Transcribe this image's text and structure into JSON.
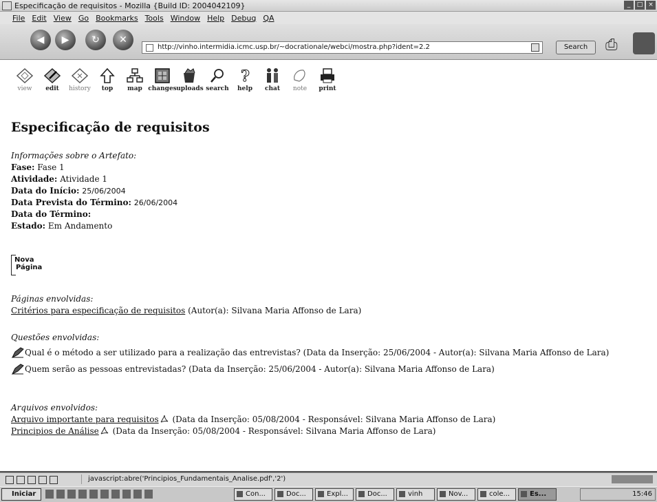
{
  "window": {
    "title": "Especificação de requisitos - Mozilla {Build ID: 2004042109}"
  },
  "menu": [
    "File",
    "Edit",
    "View",
    "Go",
    "Bookmarks",
    "Tools",
    "Window",
    "Help",
    "Debug",
    "QA"
  ],
  "nav": {
    "url": "http://vinho.intermidia.icmc.usp.br/~docrationale/webci/mostra.php?ident=2.2",
    "search_label": "Search"
  },
  "toolbar": [
    {
      "label": "view",
      "icon": "view-icon"
    },
    {
      "label": "edit",
      "icon": "edit-icon"
    },
    {
      "label": "history",
      "icon": "history-icon"
    },
    {
      "label": "top",
      "icon": "arrow-up-icon"
    },
    {
      "label": "map",
      "icon": "sitemap-icon"
    },
    {
      "label": "changes",
      "icon": "changes-icon"
    },
    {
      "label": "uploads",
      "icon": "uploads-icon"
    },
    {
      "label": "search",
      "icon": "magnifier-icon"
    },
    {
      "label": "help",
      "icon": "question-icon"
    },
    {
      "label": "chat",
      "icon": "people-icon"
    },
    {
      "label": "note",
      "icon": "note-icon"
    },
    {
      "label": "print",
      "icon": "printer-icon"
    }
  ],
  "page": {
    "title": "Especificação de requisitos",
    "info_heading": "Informações sobre o Artefato:",
    "fields": [
      {
        "label": "Fase:",
        "value": "Fase 1"
      },
      {
        "label": "Atividade:",
        "value": "Atividade 1"
      },
      {
        "label": "Data do Início:",
        "value": "25/06/2004"
      },
      {
        "label": "Data Prevista do Término:",
        "value": "26/06/2004"
      },
      {
        "label": "Data do Término:",
        "value": ""
      },
      {
        "label": "Estado:",
        "value": "Em Andamento"
      }
    ],
    "nova_pagina": {
      "line1": "Nova",
      "line2": "Página"
    },
    "paginas_heading": "Páginas envolvidas:",
    "paginas": [
      {
        "link": "Critérios para especificação de requisitos",
        "info": "(Autor(a): Silvana Maria Affonso de Lara)"
      }
    ],
    "questoes_heading": "Questões envolvidas:",
    "questoes": [
      {
        "text": "Qual é o método a ser utilizado para a realização das entrevistas? (Data da Inserção: 25/06/2004 - Autor(a): Silvana Maria Affonso de Lara)"
      },
      {
        "text": "Quem serão as pessoas entrevistadas? (Data da Inserção: 25/06/2004 - Autor(a): Silvana Maria Affonso de Lara)"
      }
    ],
    "arquivos_heading": "Arquivos envolvidos:",
    "arquivos": [
      {
        "link": "Arquivo importante para requisitos",
        "info": "(Data da Inserção: 05/08/2004 - Responsável: Silvana Maria Affonso de Lara)"
      },
      {
        "link": "Principios de Análise",
        "info": "(Data da Inserção: 05/08/2004 - Responsável: Silvana Maria Affonso de Lara)"
      }
    ]
  },
  "status": {
    "text": "javascript:abre('Principios_Fundamentais_Analise.pdf','2')"
  },
  "taskbar": {
    "start": "Iniciar",
    "tasks": [
      "Con...",
      "Doc...",
      "Expl...",
      "Doc...",
      "vinh",
      "Nov...",
      "cole...",
      "Es..."
    ],
    "clock": "15:46"
  }
}
